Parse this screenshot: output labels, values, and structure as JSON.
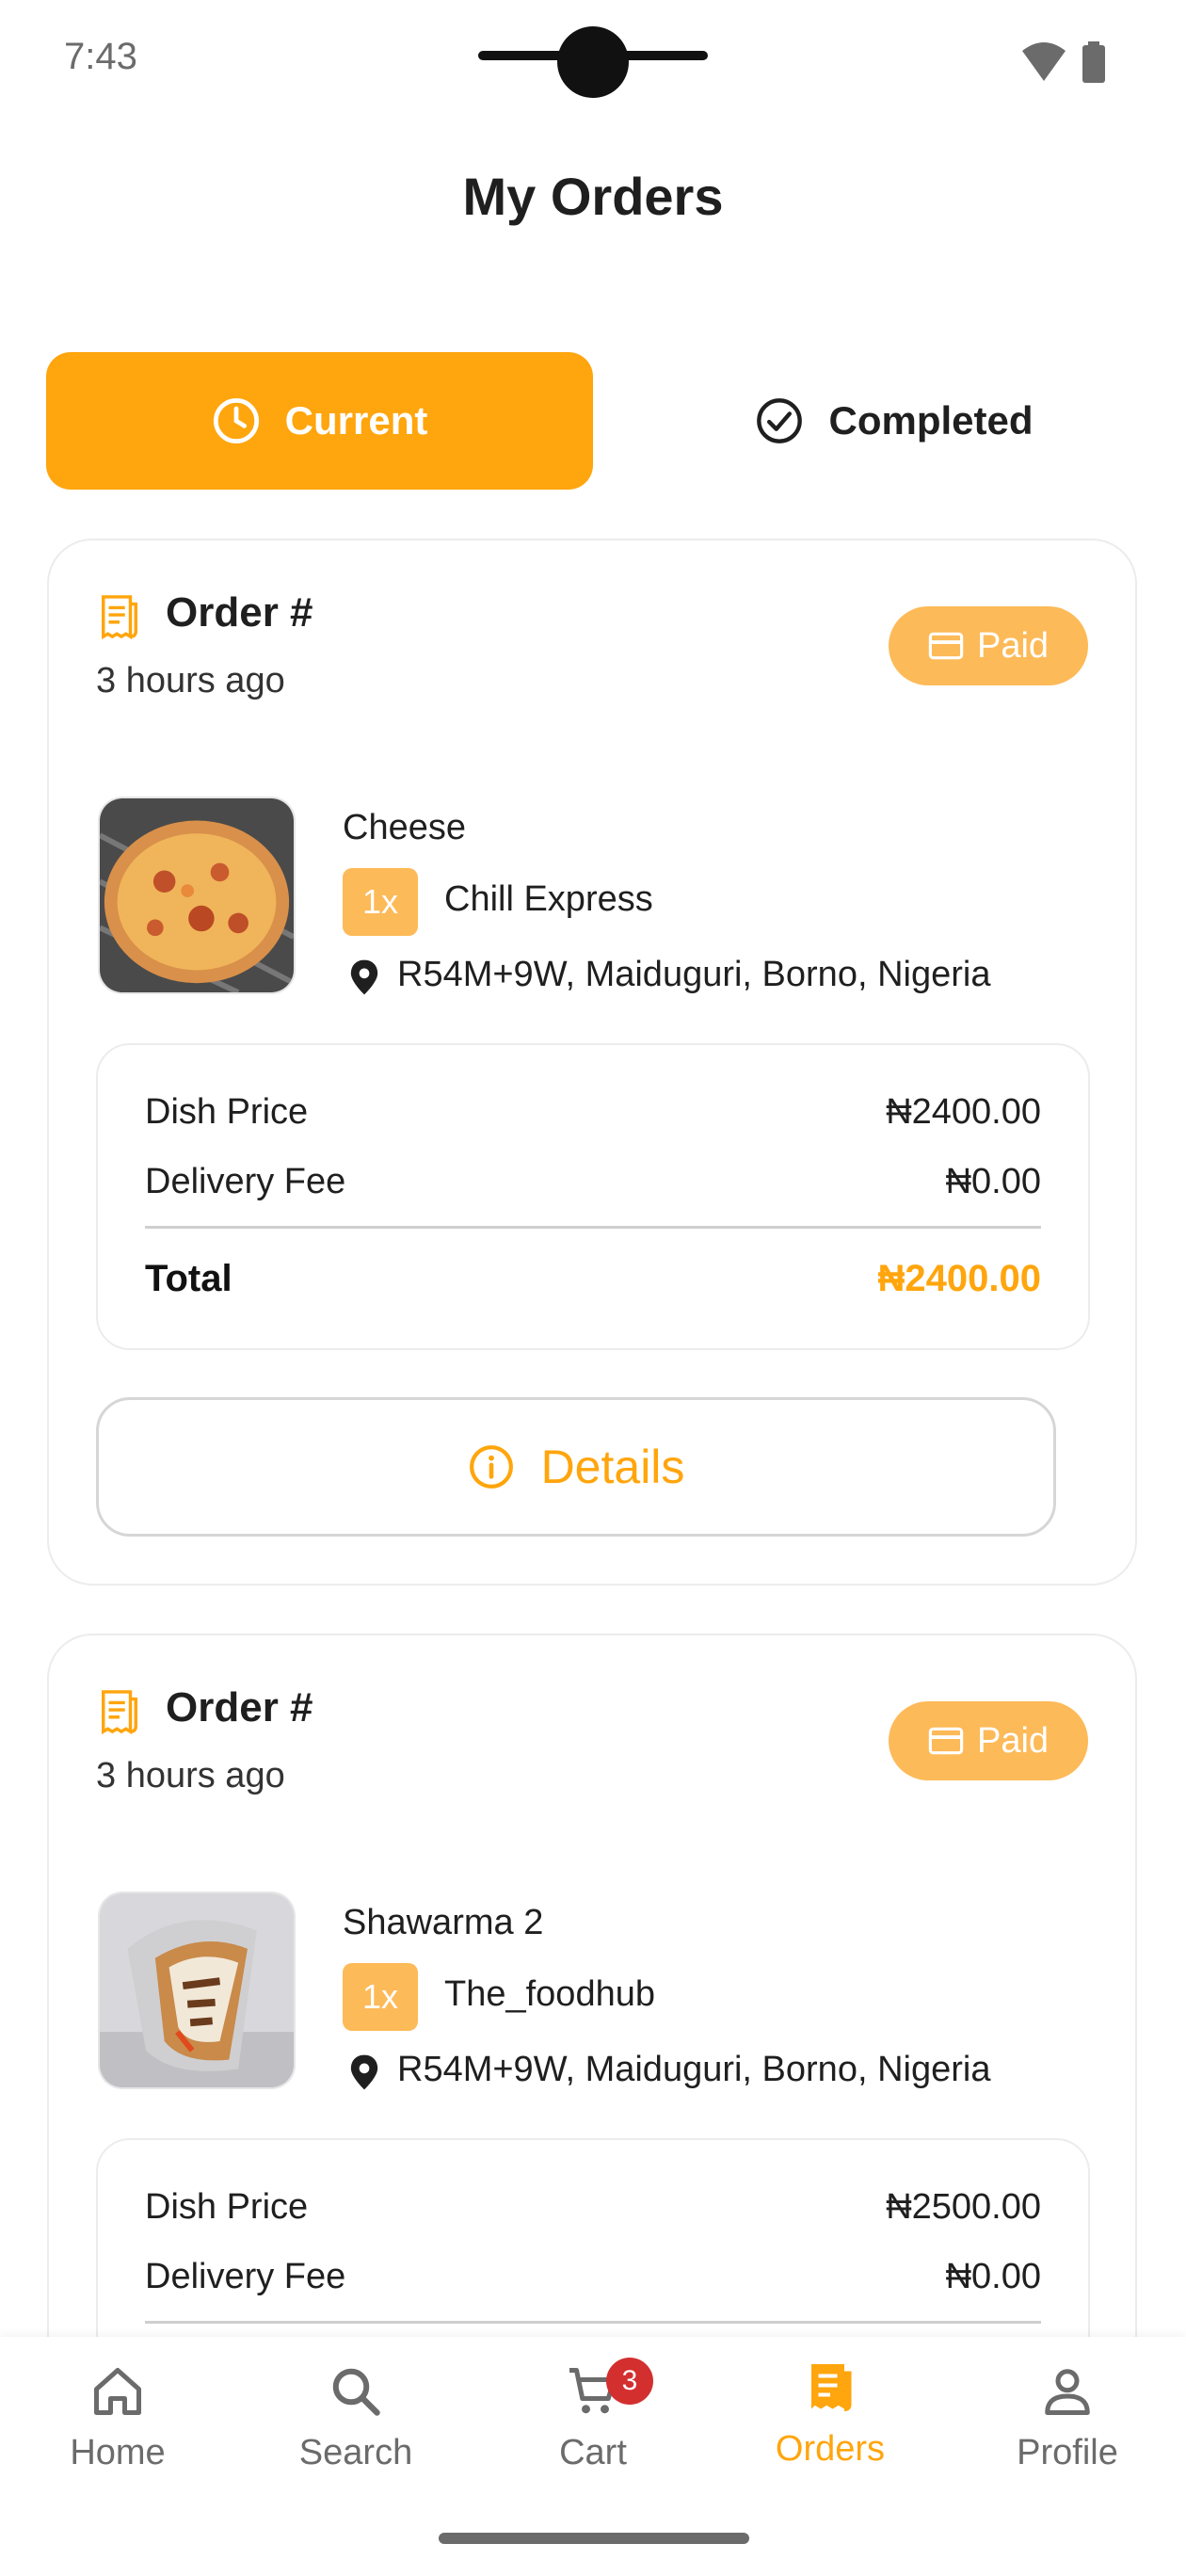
{
  "status_bar": {
    "time": "7:43"
  },
  "header": {
    "title": "My Orders"
  },
  "tabs": [
    {
      "label": "Current",
      "icon": "clock-icon",
      "active": true
    },
    {
      "label": "Completed",
      "icon": "check-circle-icon",
      "active": false
    }
  ],
  "orders": [
    {
      "title": "Order #",
      "time_ago": "3 hours ago",
      "payment_status": "Paid",
      "dish_name": "Cheese",
      "quantity": "1x",
      "restaurant": "Chill Express",
      "address": "R54M+9W, Maiduguri, Borno, Nigeria",
      "dish_price_label": "Dish Price",
      "dish_price": "₦2400.00",
      "delivery_fee_label": "Delivery Fee",
      "delivery_fee": "₦0.00",
      "total_label": "Total",
      "total": "₦2400.00",
      "details_label": "Details"
    },
    {
      "title": "Order #",
      "time_ago": "3 hours ago",
      "payment_status": "Paid",
      "dish_name": "Shawarma 2",
      "quantity": "1x",
      "restaurant": "The_foodhub",
      "address": "R54M+9W, Maiduguri, Borno, Nigeria",
      "dish_price_label": "Dish Price",
      "dish_price": "₦2500.00",
      "delivery_fee_label": "Delivery Fee",
      "delivery_fee": "₦0.00"
    }
  ],
  "bottom_nav": [
    {
      "label": "Home",
      "icon": "home-icon"
    },
    {
      "label": "Search",
      "icon": "search-icon"
    },
    {
      "label": "Cart",
      "icon": "cart-icon",
      "badge": "3"
    },
    {
      "label": "Orders",
      "icon": "receipt-icon",
      "active": true
    },
    {
      "label": "Profile",
      "icon": "person-icon"
    }
  ],
  "colors": {
    "accent": "#FFA50D",
    "badge_bg": "#FDBA58",
    "cart_badge": "#d32f2f"
  }
}
